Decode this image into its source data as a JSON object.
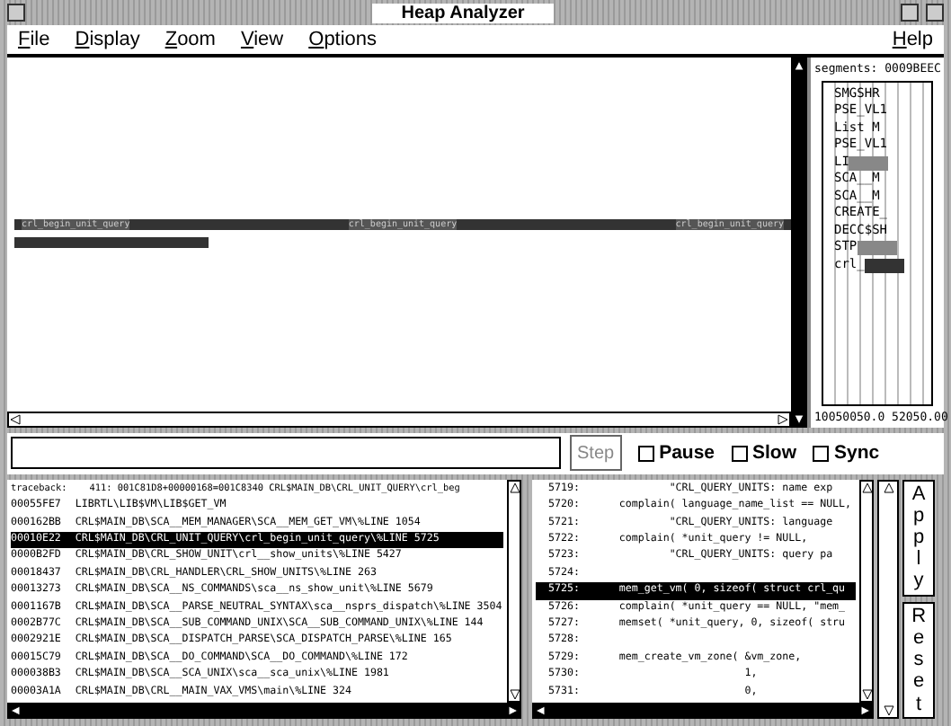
{
  "window": {
    "title": "Heap Analyzer"
  },
  "menu": [
    {
      "label": "File"
    },
    {
      "label": "Display"
    },
    {
      "label": "Zoom"
    },
    {
      "label": "View"
    },
    {
      "label": "Options"
    }
  ],
  "help_menu": {
    "label": "Help"
  },
  "heap_view": {
    "bars": [
      {
        "labels": [
          "crl_begin_unit_query",
          "crl_begin_unit_query",
          "crl_begin_unit_query"
        ],
        "level": 1
      },
      {
        "level": 0.25
      }
    ]
  },
  "segments": {
    "header": "segments: 0009BEEC",
    "items": [
      {
        "label": "SMGSHR",
        "kind": "plain"
      },
      {
        "label": "PSE_VL1",
        "kind": "plain"
      },
      {
        "label": "List M",
        "kind": "plain"
      },
      {
        "label": "PSE_VL1",
        "kind": "plain"
      },
      {
        "label": "LI",
        "kind": "shaded"
      },
      {
        "label": "SCA__M",
        "kind": "plain"
      },
      {
        "label": "SCA__M",
        "kind": "plain"
      },
      {
        "label": "CREATE_",
        "kind": "plain"
      },
      {
        "label": "DECC$SH",
        "kind": "plain"
      },
      {
        "label": "STP",
        "kind": "shaded"
      },
      {
        "label": "crl_",
        "kind": "dark"
      }
    ],
    "footer": "10050050.0 52050.00"
  },
  "controls": {
    "step": {
      "label": "Step",
      "disabled": true
    },
    "options": [
      {
        "label": "Pause",
        "checked": false
      },
      {
        "label": "Slow",
        "checked": false
      },
      {
        "label": "Sync",
        "checked": false
      }
    ]
  },
  "traceback": {
    "header": "traceback:    411: 001C81D8+00000168=001C8340 CRL$MAIN_DB\\CRL_UNIT_QUERY\\crl_beg",
    "rows": [
      {
        "address": "00055FE7",
        "location": "LIBRTL\\LIB$VM\\LIB$GET_VM",
        "selected": false
      },
      {
        "address": "000162BB",
        "location": "CRL$MAIN_DB\\SCA__MEM_MANAGER\\SCA__MEM_GET_VM\\%LINE 1054",
        "selected": false
      },
      {
        "address": "00010E22",
        "location": "CRL$MAIN_DB\\CRL_UNIT_QUERY\\crl_begin_unit_query\\%LINE 5725",
        "selected": true
      },
      {
        "address": "0000B2FD",
        "location": "CRL$MAIN_DB\\CRL_SHOW_UNIT\\crl__show_units\\%LINE 5427",
        "selected": false
      },
      {
        "address": "00018437",
        "location": "CRL$MAIN_DB\\CRL_HANDLER\\CRL_SHOW_UNITS\\%LINE 263",
        "selected": false
      },
      {
        "address": "00013273",
        "location": "CRL$MAIN_DB\\SCA__NS_COMMANDS\\sca__ns_show_unit\\%LINE 5679",
        "selected": false
      },
      {
        "address": "0001167B",
        "location": "CRL$MAIN_DB\\SCA__PARSE_NEUTRAL_SYNTAX\\sca__nsprs_dispatch\\%LINE 3504",
        "selected": false
      },
      {
        "address": "0002B77C",
        "location": "CRL$MAIN_DB\\SCA__SUB_COMMAND_UNIX\\SCA__SUB_COMMAND_UNIX\\%LINE 144",
        "selected": false
      },
      {
        "address": "0002921E",
        "location": "CRL$MAIN_DB\\SCA__DISPATCH_PARSE\\SCA_DISPATCH_PARSE\\%LINE 165",
        "selected": false
      },
      {
        "address": "00015C79",
        "location": "CRL$MAIN_DB\\SCA__DO_COMMAND\\SCA__DO_COMMAND\\%LINE 172",
        "selected": false
      },
      {
        "address": "000038B3",
        "location": "CRL$MAIN_DB\\SCA__SCA_UNIX\\sca__sca_unix\\%LINE 1981",
        "selected": false
      },
      {
        "address": "00003A1A",
        "location": "CRL$MAIN_DB\\CRL__MAIN_VAX_VMS\\main\\%LINE 324",
        "selected": false
      }
    ]
  },
  "source": {
    "rows": [
      {
        "line": "5719:",
        "code": "            \"CRL_QUERY_UNITS: name exp",
        "selected": false
      },
      {
        "line": "5720:",
        "code": "    complain( language_name_list == NULL,",
        "selected": false
      },
      {
        "line": "5721:",
        "code": "            \"CRL_QUERY_UNITS: language",
        "selected": false
      },
      {
        "line": "5722:",
        "code": "    complain( *unit_query != NULL,",
        "selected": false
      },
      {
        "line": "5723:",
        "code": "            \"CRL_QUERY_UNITS: query pa",
        "selected": false
      },
      {
        "line": "5724:",
        "code": "",
        "selected": false
      },
      {
        "line": "5725:",
        "code": "    mem_get_vm( 0, sizeof( struct crl_qu",
        "selected": true
      },
      {
        "line": "5726:",
        "code": "    complain( *unit_query == NULL, \"mem_",
        "selected": false
      },
      {
        "line": "5727:",
        "code": "    memset( *unit_query, 0, sizeof( stru",
        "selected": false
      },
      {
        "line": "5728:",
        "code": "",
        "selected": false
      },
      {
        "line": "5729:",
        "code": "    mem_create_vm_zone( &vm_zone,",
        "selected": false
      },
      {
        "line": "5730:",
        "code": "                        1,",
        "selected": false
      },
      {
        "line": "5731:",
        "code": "                        0,",
        "selected": false
      }
    ]
  },
  "actions": [
    {
      "label": "Apply"
    },
    {
      "label": "Reset"
    }
  ]
}
